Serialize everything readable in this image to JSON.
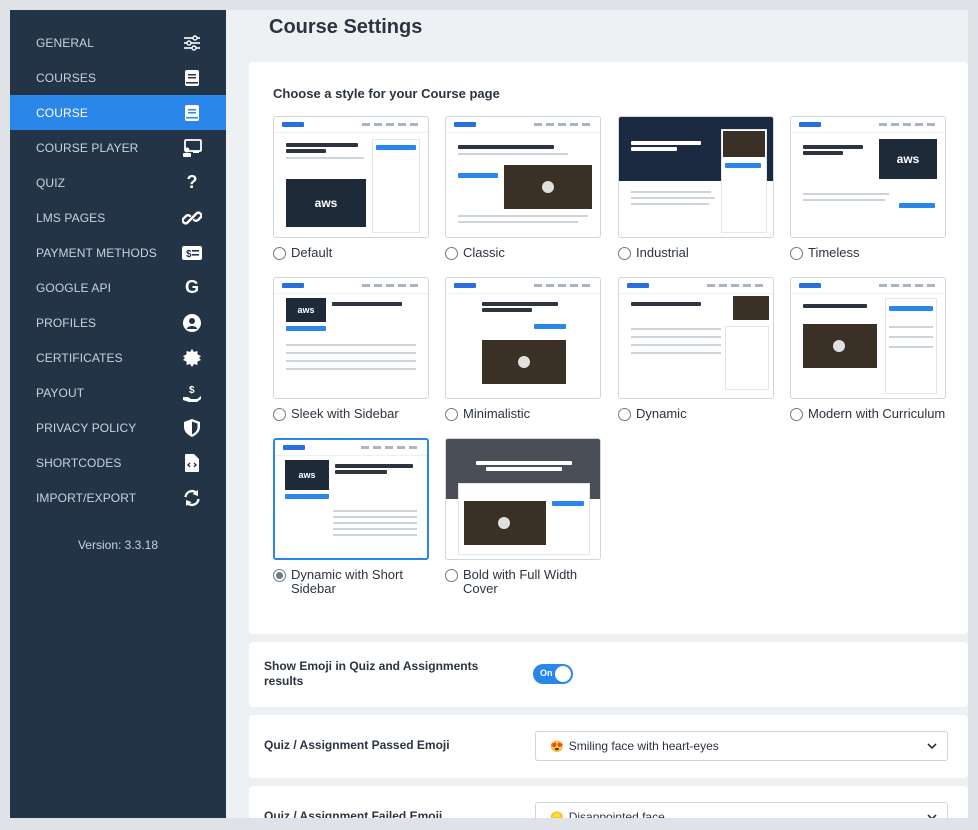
{
  "sidebar": {
    "items": [
      {
        "label": "GENERAL",
        "icon": "sliders-icon"
      },
      {
        "label": "COURSES",
        "icon": "book-icon"
      },
      {
        "label": "COURSE",
        "icon": "book-icon",
        "active": true
      },
      {
        "label": "COURSE PLAYER",
        "icon": "presentation-icon"
      },
      {
        "label": "QUIZ",
        "icon": "question-icon"
      },
      {
        "label": "LMS PAGES",
        "icon": "link-icon"
      },
      {
        "label": "PAYMENT METHODS",
        "icon": "money-icon"
      },
      {
        "label": "GOOGLE API",
        "icon": "google-icon"
      },
      {
        "label": "PROFILES",
        "icon": "user-circle-icon"
      },
      {
        "label": "CERTIFICATES",
        "icon": "certificate-icon"
      },
      {
        "label": "PAYOUT",
        "icon": "hand-dollar-icon"
      },
      {
        "label": "PRIVACY POLICY",
        "icon": "shield-icon"
      },
      {
        "label": "SHORTCODES",
        "icon": "code-file-icon"
      },
      {
        "label": "IMPORT/EXPORT",
        "icon": "sync-icon"
      }
    ],
    "version": "Version: 3.3.18"
  },
  "main": {
    "title": "Course Settings",
    "style_section_label": "Choose a style for your Course page",
    "styles": [
      {
        "label": "Default",
        "selected": false
      },
      {
        "label": "Classic",
        "selected": false
      },
      {
        "label": "Industrial",
        "selected": false
      },
      {
        "label": "Timeless",
        "selected": false
      },
      {
        "label": "Sleek with Sidebar",
        "selected": false
      },
      {
        "label": "Minimalistic",
        "selected": false
      },
      {
        "label": "Dynamic",
        "selected": false
      },
      {
        "label": "Modern with Curriculum",
        "selected": false
      },
      {
        "label": "Dynamic with Short Sidebar",
        "selected": true
      },
      {
        "label": "Bold with Full Width Cover",
        "selected": false
      }
    ],
    "emoji_toggle": {
      "label": "Show Emoji in Quiz and Assignments results",
      "state": "On"
    },
    "passed_emoji": {
      "label": "Quiz / Assignment Passed Emoji",
      "emoji": "😍",
      "value": "Smiling face with heart-eyes"
    },
    "failed_emoji": {
      "label": "Quiz / Assignment Failed Emoji",
      "emoji": "😞",
      "value": "Disappointed face"
    }
  },
  "colors": {
    "sidebar_bg": "#243447",
    "accent": "#2a86e8"
  }
}
